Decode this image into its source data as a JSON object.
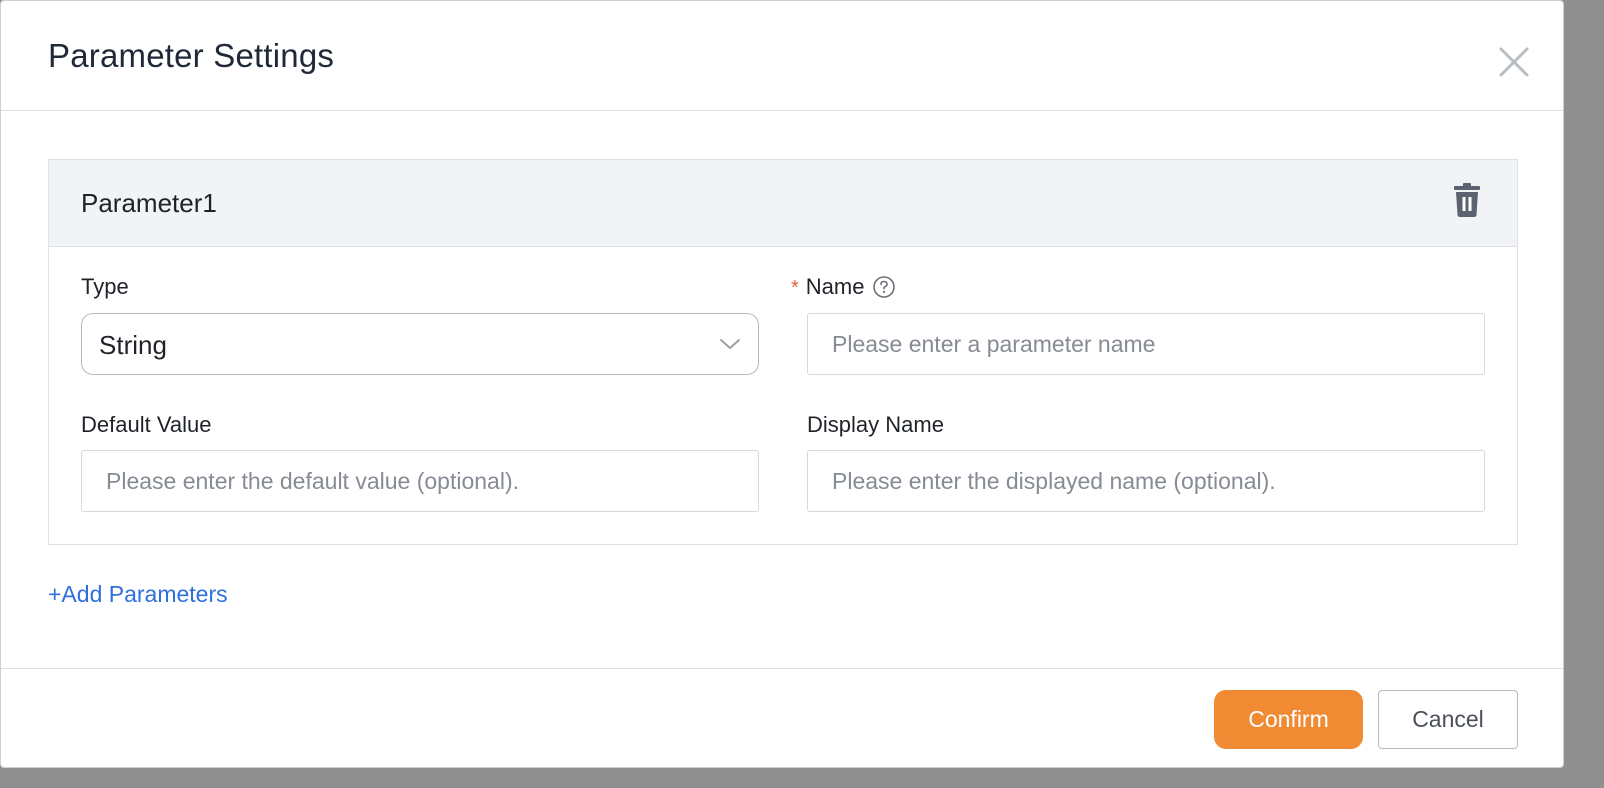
{
  "dialog": {
    "title": "Parameter Settings",
    "close_icon": "close-icon"
  },
  "parameter": {
    "title": "Parameter1",
    "delete_icon": "trash-icon",
    "type": {
      "label": "Type",
      "value": "String"
    },
    "name": {
      "label": "Name",
      "required_mark": "*",
      "help_icon": "question-circle-icon",
      "value": "",
      "placeholder": "Please enter a parameter name"
    },
    "default_value": {
      "label": "Default Value",
      "value": "",
      "placeholder": "Please enter the default value (optional)."
    },
    "display_name": {
      "label": "Display Name",
      "value": "",
      "placeholder": "Please enter the displayed name (optional)."
    }
  },
  "add_parameters_label": "+Add Parameters",
  "footer": {
    "confirm_label": "Confirm",
    "cancel_label": "Cancel"
  },
  "colors": {
    "accent": "#f08b34",
    "link": "#2f6fde",
    "required": "#e0643a"
  }
}
